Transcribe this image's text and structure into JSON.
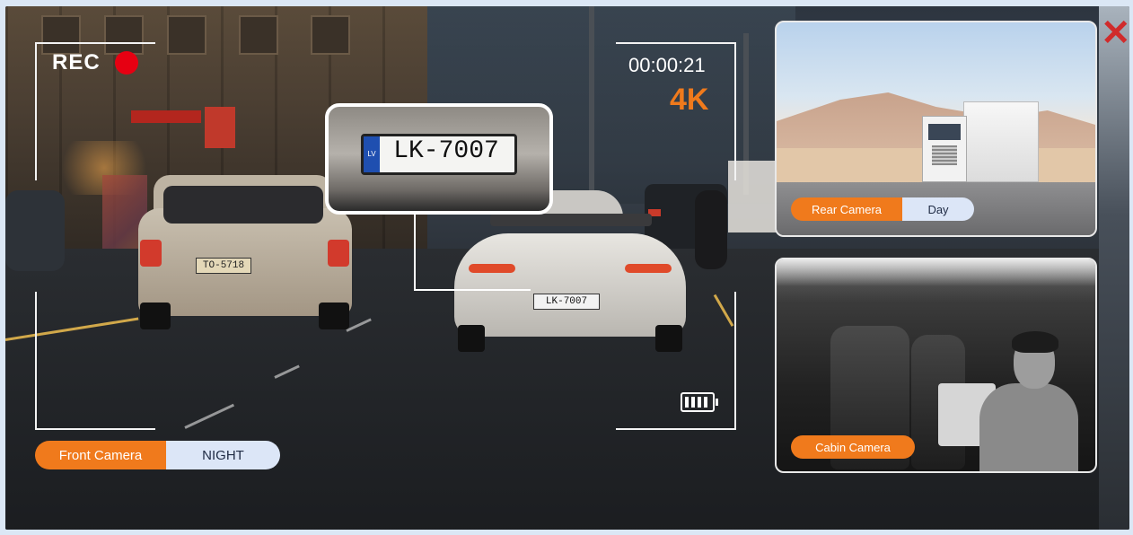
{
  "overlay": {
    "rec_label": "REC",
    "timer": "00:00:21",
    "resolution": "4K",
    "battery_icon": "battery-full-icon",
    "rec_indicator_color": "#e60012",
    "accent_color": "#f07a1c"
  },
  "scene": {
    "zoom_plate_text": "LK-7007",
    "zoom_plate_country": "LV",
    "porsche_plate_text": "LK-7007",
    "peugeot_plate_text": "TO-5718"
  },
  "front_camera": {
    "label": "Front Camera",
    "mode": "NIGHT"
  },
  "rear_camera": {
    "label": "Rear Camera",
    "mode": "Day"
  },
  "cabin_camera": {
    "label": "Cabin Camera"
  }
}
